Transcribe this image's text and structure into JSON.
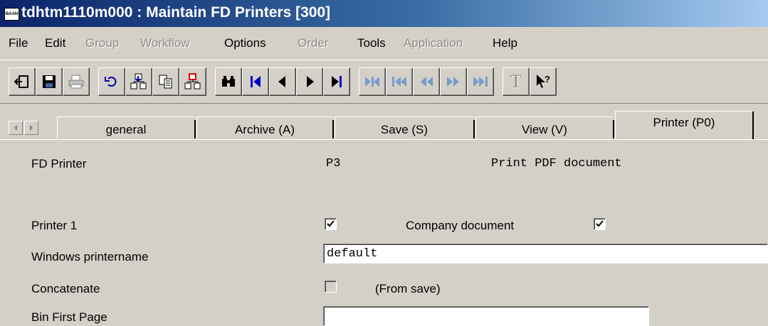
{
  "window": {
    "title": "tdhtm1110m000 : Maintain FD Printers [300]",
    "icon_text": "BAAN"
  },
  "menu": [
    {
      "label": "File",
      "enabled": true
    },
    {
      "label": "Edit",
      "enabled": true
    },
    {
      "label": "Group",
      "enabled": false
    },
    {
      "label": "Workflow",
      "enabled": false
    },
    {
      "label": "Options",
      "enabled": true
    },
    {
      "label": "Order",
      "enabled": false
    },
    {
      "label": "Tools",
      "enabled": true
    },
    {
      "label": "Application",
      "enabled": false
    },
    {
      "label": "Help",
      "enabled": true
    }
  ],
  "toolbar": {
    "text_button_label": "T"
  },
  "tabs": [
    {
      "label": "general",
      "active": false
    },
    {
      "label": "Archive (A)",
      "active": false
    },
    {
      "label": "Save (S)",
      "active": false
    },
    {
      "label": "View (V)",
      "active": false
    },
    {
      "label": "Printer (P0)",
      "active": true
    }
  ],
  "form": {
    "fd_printer_label": "FD Printer",
    "fd_printer_code": "P3",
    "fd_printer_desc": "Print PDF document",
    "printer1_label": "Printer 1",
    "printer1_checked": true,
    "company_document_label": "Company document",
    "company_document_checked": true,
    "windows_printername_label": "Windows printername",
    "windows_printername_value": "default",
    "concatenate_label": "Concatenate",
    "concatenate_checked": false,
    "from_save_label": "(From save)",
    "bin_first_page_label": "Bin First Page",
    "bin_first_page_value": ""
  }
}
